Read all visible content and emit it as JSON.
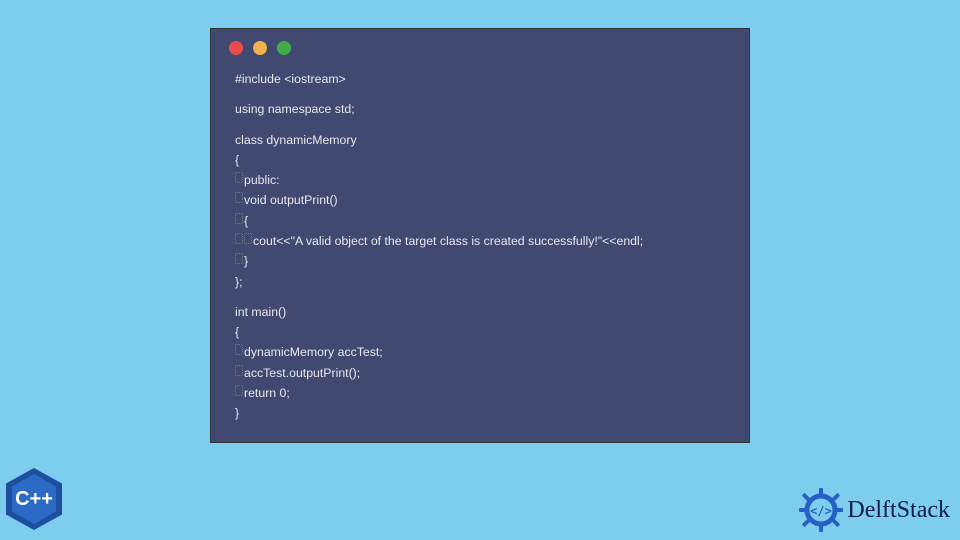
{
  "code": {
    "lines": [
      "#include <iostream>",
      "",
      "using namespace std;",
      "",
      "class dynamicMemory",
      "{",
      "▯public:",
      "▯void outputPrint()",
      "▯{",
      "▯▯cout<<\"A valid object of the target class is created successfully!\"<<endl;",
      "▯}",
      "};",
      "",
      "int main()",
      "{",
      "▯dynamicMemory accTest;",
      "▯accTest.outputPrint();",
      "▯return 0;",
      "}"
    ]
  },
  "logo_cpp": {
    "label": "C++"
  },
  "brand": {
    "name": "DelftStack"
  }
}
